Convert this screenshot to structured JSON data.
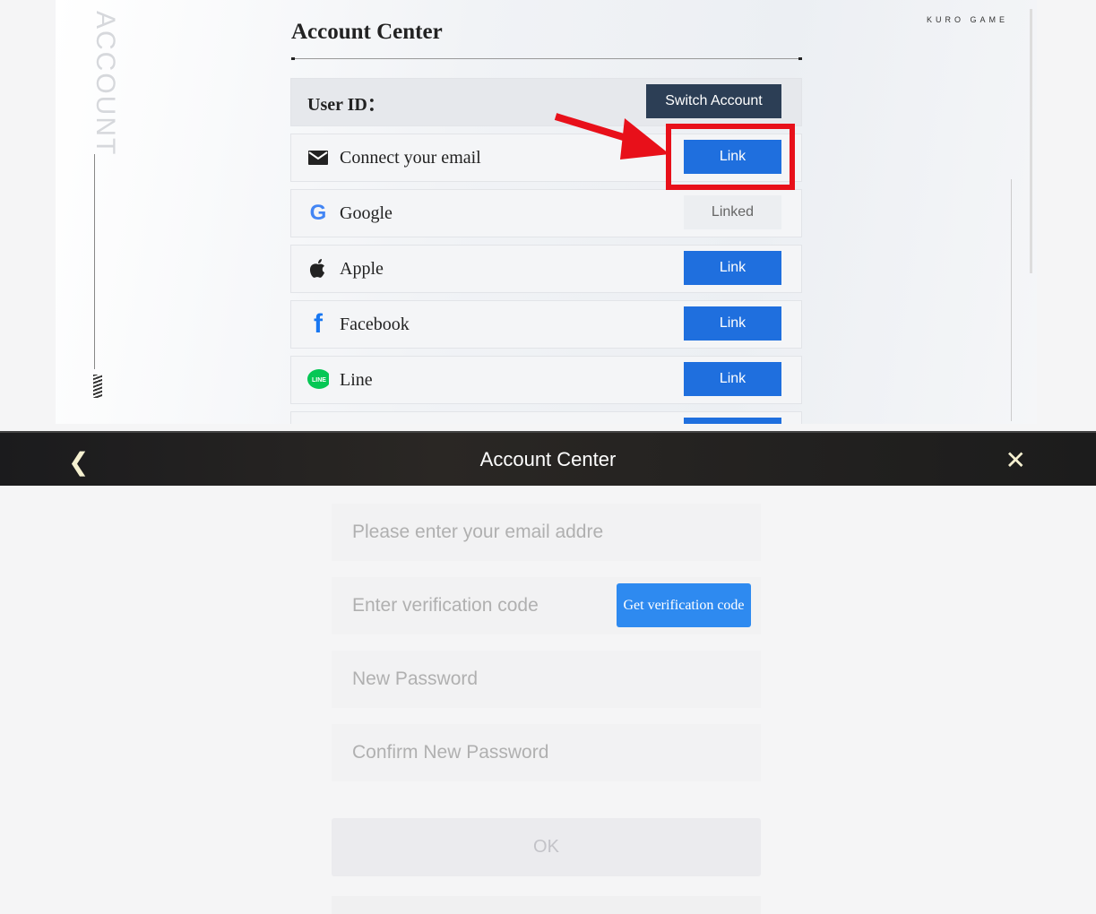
{
  "top_panel": {
    "side_label": "ACCOUNT",
    "brand": "KURO GAME",
    "title": "Account Center",
    "user_id_label": "User ID：",
    "switch_account": "Switch Account",
    "accounts": [
      {
        "icon": "email-icon",
        "label": "Connect your email",
        "action": "Link",
        "linked": false,
        "highlighted": true
      },
      {
        "icon": "google-icon",
        "label": "Google",
        "action": "Linked",
        "linked": true
      },
      {
        "icon": "apple-icon",
        "label": "Apple",
        "action": "Link",
        "linked": false
      },
      {
        "icon": "facebook-icon",
        "label": "Facebook",
        "action": "Link",
        "linked": false
      },
      {
        "icon": "line-icon",
        "label": "Line",
        "action": "Link",
        "linked": false
      }
    ],
    "colors": {
      "link_button": "#1f6fde",
      "highlight": "#e8101a"
    }
  },
  "header": {
    "title": "Account Center"
  },
  "form": {
    "email_placeholder": "Please enter your email address",
    "code_placeholder": "Enter verification code",
    "get_code": "Get verification code",
    "password_placeholder": "New Password",
    "confirm_placeholder": "Confirm New Password",
    "ok": "OK"
  }
}
